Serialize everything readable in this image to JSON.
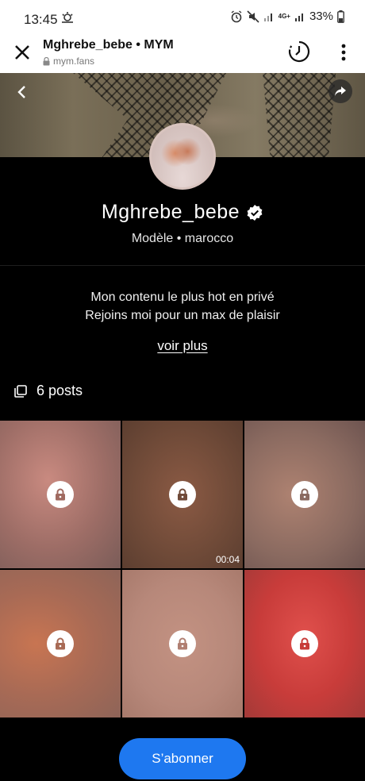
{
  "status_bar": {
    "time": "13:45",
    "network": "4G+",
    "battery": "33%",
    "icons": [
      "weather-icon",
      "alarm-icon",
      "mute-icon",
      "signal-icon",
      "signal-icon",
      "battery-icon"
    ]
  },
  "browser": {
    "title": "Mghrebe_bebe • MYM",
    "url": "mym.fans",
    "icons": [
      "close-icon",
      "lock-icon",
      "history-icon",
      "more-vert-icon"
    ]
  },
  "profile": {
    "name": "Mghrebe_bebe",
    "subtitle": "Modèle • marocco",
    "bio_line1": "Mon contenu le plus hot en privé",
    "bio_line2": "Rejoins moi pour un max de plaisir",
    "see_more": "voir plus"
  },
  "posts": {
    "count_label": "6 posts",
    "items": [
      {
        "locked": true,
        "duration": ""
      },
      {
        "locked": true,
        "duration": "00:04"
      },
      {
        "locked": true,
        "duration": ""
      },
      {
        "locked": true,
        "duration": ""
      },
      {
        "locked": true,
        "duration": ""
      },
      {
        "locked": true,
        "duration": ""
      }
    ]
  },
  "cta": {
    "subscribe_label": "S’abonner"
  },
  "colors": {
    "accent": "#1e78f0",
    "background": "#000000"
  }
}
